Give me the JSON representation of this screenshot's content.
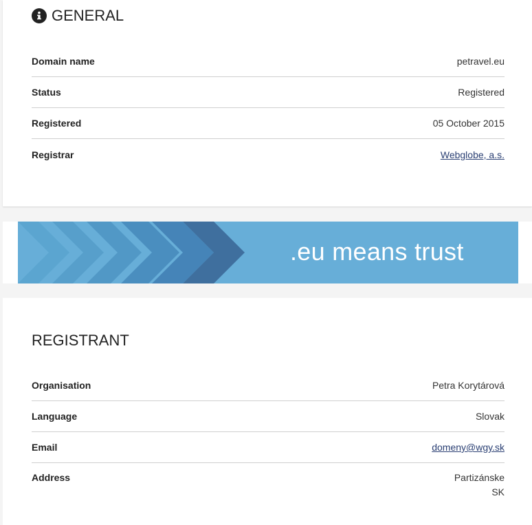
{
  "general": {
    "title": "GENERAL",
    "rows": [
      {
        "label": "Domain name",
        "value": "petravel.eu"
      },
      {
        "label": "Status",
        "value": "Registered"
      },
      {
        "label": "Registered",
        "value": "05 October 2015"
      },
      {
        "label": "Registrar",
        "value": "Webglobe, a.s."
      }
    ]
  },
  "banner": {
    "text": ".eu means trust",
    "color": "#67aed8"
  },
  "registrant": {
    "title": "REGISTRANT",
    "rows": [
      {
        "label": "Organisation",
        "value": "Petra Korytárová"
      },
      {
        "label": "Language",
        "value": "Slovak"
      },
      {
        "label": "Email",
        "value": "domeny@wgy.sk"
      },
      {
        "label": "Address",
        "value_line1": "Partizánske",
        "value_line2": "SK"
      }
    ]
  },
  "icons": {
    "general_icon": "info-icon"
  },
  "colors": {
    "link": "#2a3f73",
    "divider": "#cfcfcf",
    "banner_dark": "#3f6f9e"
  }
}
